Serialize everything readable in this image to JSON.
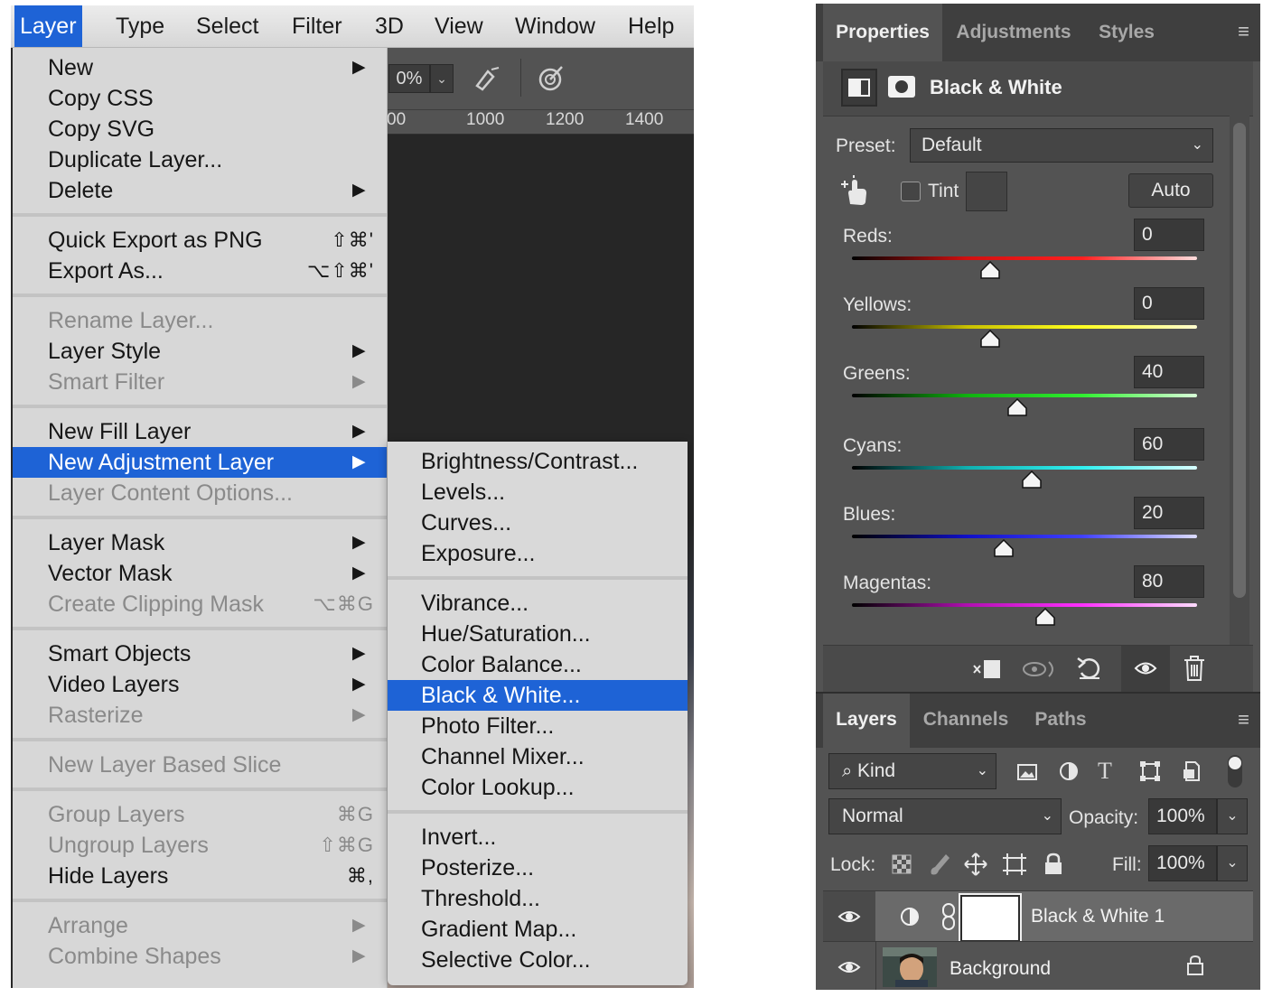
{
  "menubar": {
    "items": [
      "Layer",
      "Type",
      "Select",
      "Filter",
      "3D",
      "View",
      "Window",
      "Help"
    ]
  },
  "toolbar": {
    "zoom_value": "0%"
  },
  "ruler": {
    "ticks": [
      "00",
      "1000",
      "1200",
      "1400"
    ]
  },
  "layer_menu": {
    "items": [
      {
        "label": "New",
        "submenu": true
      },
      {
        "label": "Copy CSS"
      },
      {
        "label": "Copy SVG"
      },
      {
        "label": "Duplicate Layer..."
      },
      {
        "label": "Delete",
        "submenu": true
      },
      {
        "label": "Quick Export as PNG",
        "shortcut": "⇧⌘'"
      },
      {
        "label": "Export As...",
        "shortcut": "⌥⇧⌘'"
      },
      {
        "label": "Rename Layer...",
        "disabled": true
      },
      {
        "label": "Layer Style",
        "submenu": true
      },
      {
        "label": "Smart Filter",
        "submenu": true,
        "disabled": true
      },
      {
        "label": "New Fill Layer",
        "submenu": true
      },
      {
        "label": "New Adjustment Layer",
        "submenu": true,
        "selected": true
      },
      {
        "label": "Layer Content Options...",
        "disabled": true
      },
      {
        "label": "Layer Mask",
        "submenu": true
      },
      {
        "label": "Vector Mask",
        "submenu": true
      },
      {
        "label": "Create Clipping Mask",
        "shortcut": "⌥⌘G",
        "disabled": true
      },
      {
        "label": "Smart Objects",
        "submenu": true
      },
      {
        "label": "Video Layers",
        "submenu": true
      },
      {
        "label": "Rasterize",
        "submenu": true,
        "disabled": true
      },
      {
        "label": "New Layer Based Slice",
        "disabled": true
      },
      {
        "label": "Group Layers",
        "shortcut": "⌘G",
        "disabled": true
      },
      {
        "label": "Ungroup Layers",
        "shortcut": "⇧⌘G",
        "disabled": true
      },
      {
        "label": "Hide Layers",
        "shortcut": "⌘,"
      },
      {
        "label": "Arrange",
        "submenu": true,
        "disabled": true
      },
      {
        "label": "Combine Shapes",
        "submenu": true,
        "disabled": true
      }
    ]
  },
  "adjustment_submenu": {
    "items": [
      {
        "label": "Brightness/Contrast..."
      },
      {
        "label": "Levels..."
      },
      {
        "label": "Curves..."
      },
      {
        "label": "Exposure..."
      },
      {
        "label": "Vibrance..."
      },
      {
        "label": "Hue/Saturation..."
      },
      {
        "label": "Color Balance..."
      },
      {
        "label": "Black & White...",
        "selected": true
      },
      {
        "label": "Photo Filter..."
      },
      {
        "label": "Channel Mixer..."
      },
      {
        "label": "Color Lookup..."
      },
      {
        "label": "Invert..."
      },
      {
        "label": "Posterize..."
      },
      {
        "label": "Threshold..."
      },
      {
        "label": "Gradient Map..."
      },
      {
        "label": "Selective Color..."
      }
    ]
  },
  "properties_panel": {
    "tabs": [
      "Properties",
      "Adjustments",
      "Styles"
    ],
    "title": "Black & White",
    "preset_label": "Preset:",
    "preset_value": "Default",
    "tint_label": "Tint",
    "auto_label": "Auto",
    "sliders": [
      {
        "label": "Reds:",
        "value": "0",
        "position": 0.4,
        "colors": [
          "#000000",
          "#d01010",
          "#ff2020",
          "#ffdcdc"
        ]
      },
      {
        "label": "Yellows:",
        "value": "0",
        "position": 0.4,
        "colors": [
          "#000000",
          "#c8c000",
          "#ffff20",
          "#fffcd0"
        ]
      },
      {
        "label": "Greens:",
        "value": "40",
        "position": 0.48,
        "colors": [
          "#000000",
          "#10b010",
          "#30f030",
          "#d8ffd8"
        ]
      },
      {
        "label": "Cyans:",
        "value": "60",
        "position": 0.52,
        "colors": [
          "#000000",
          "#10b0b0",
          "#30f0f0",
          "#d8ffff"
        ]
      },
      {
        "label": "Blues:",
        "value": "20",
        "position": 0.44,
        "colors": [
          "#000000",
          "#1010c8",
          "#4040ff",
          "#dcdcff"
        ]
      },
      {
        "label": "Magentas:",
        "value": "80",
        "position": 0.56,
        "colors": [
          "#000000",
          "#b010b0",
          "#ff30ff",
          "#ffdcff"
        ]
      }
    ]
  },
  "layers_panel": {
    "tabs": [
      "Layers",
      "Channels",
      "Paths"
    ],
    "kind_label": "Kind",
    "blend_mode": "Normal",
    "opacity_label": "Opacity:",
    "opacity_value": "100%",
    "lock_label": "Lock:",
    "fill_label": "Fill:",
    "fill_value": "100%",
    "layers": [
      {
        "name": "Black & White 1",
        "selected": true
      },
      {
        "name": "Background"
      }
    ]
  },
  "colors": {
    "accent": "#1e63d6",
    "panel": "#535353",
    "menu": "#d7d7d7"
  }
}
